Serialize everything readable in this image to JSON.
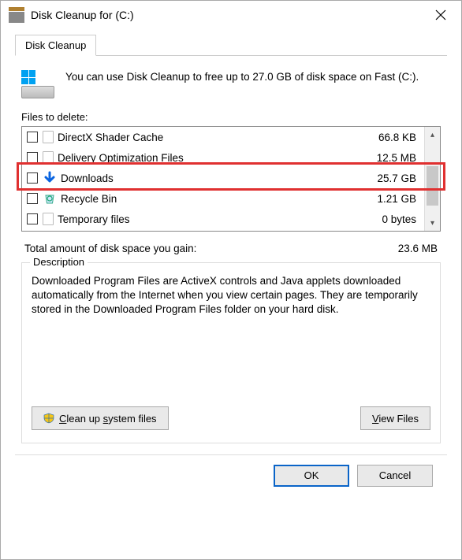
{
  "window": {
    "title": "Disk Cleanup for  (C:)"
  },
  "tab": {
    "label": "Disk Cleanup"
  },
  "intro": "You can use Disk Cleanup to free up to 27.0 GB of disk space on Fast (C:).",
  "files_label": "Files to delete:",
  "files": [
    {
      "name": "DirectX Shader Cache",
      "size": "66.8 KB",
      "icon": "page"
    },
    {
      "name": "Delivery Optimization Files",
      "size": "12.5 MB",
      "icon": "page"
    },
    {
      "name": "Downloads",
      "size": "25.7 GB",
      "icon": "download"
    },
    {
      "name": "Recycle Bin",
      "size": "1.21 GB",
      "icon": "recycle"
    },
    {
      "name": "Temporary files",
      "size": "0 bytes",
      "icon": "page"
    }
  ],
  "total": {
    "label": "Total amount of disk space you gain:",
    "value": "23.6 MB"
  },
  "description": {
    "legend": "Description",
    "text": "Downloaded Program Files are ActiveX controls and Java applets downloaded automatically from the Internet when you view certain pages. They are temporarily stored in the Downloaded Program Files folder on your hard disk."
  },
  "buttons": {
    "clean_system": "Clean up system files",
    "view_files": "View Files",
    "ok": "OK",
    "cancel": "Cancel"
  }
}
